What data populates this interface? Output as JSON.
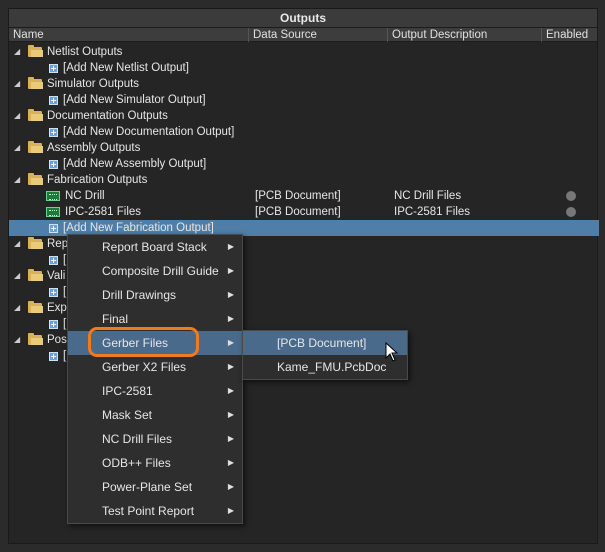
{
  "panel": {
    "title": "Outputs",
    "columns": {
      "name": "Name",
      "data_source": "Data Source",
      "output_description": "Output Description",
      "enabled": "Enabled"
    }
  },
  "tree": {
    "netlist": {
      "label": "Netlist Outputs",
      "add": "[Add New Netlist Output]"
    },
    "simulator": {
      "label": "Simulator Outputs",
      "add": "[Add New Simulator Output]"
    },
    "documentation": {
      "label": "Documentation Outputs",
      "add": "[Add New Documentation Output]"
    },
    "assembly": {
      "label": "Assembly Outputs",
      "add": "[Add New Assembly Output]"
    },
    "fabrication": {
      "label": "Fabrication Outputs",
      "items": [
        {
          "name": "NC Drill",
          "data_source": "[PCB Document]",
          "description": "NC Drill Files"
        },
        {
          "name": "IPC-2581 Files",
          "data_source": "[PCB Document]",
          "description": "IPC-2581 Files"
        }
      ],
      "add": "[Add New Fabrication Output]"
    },
    "report": {
      "label": "Rep",
      "add": "["
    },
    "validation": {
      "label": "Vali",
      "add": "["
    },
    "export": {
      "label": "Expo",
      "add": "["
    },
    "post": {
      "label": "Post",
      "add": "["
    }
  },
  "context_menu": {
    "items": [
      "Report Board Stack",
      "Composite Drill Guide",
      "Drill Drawings",
      "Final",
      "Gerber Files",
      "Gerber X2 Files",
      "IPC-2581",
      "Mask Set",
      "NC Drill Files",
      "ODB++ Files",
      "Power-Plane Set",
      "Test Point Report"
    ],
    "highlighted": "Gerber Files"
  },
  "submenu": {
    "items": [
      "[PCB Document]",
      "Kame_FMU.PcbDoc"
    ],
    "highlighted": "[PCB Document]"
  },
  "colors": {
    "accent_ring": "#f07a1e",
    "selection": "#4f7fa8",
    "menu_highlight": "#4a6a8c"
  }
}
